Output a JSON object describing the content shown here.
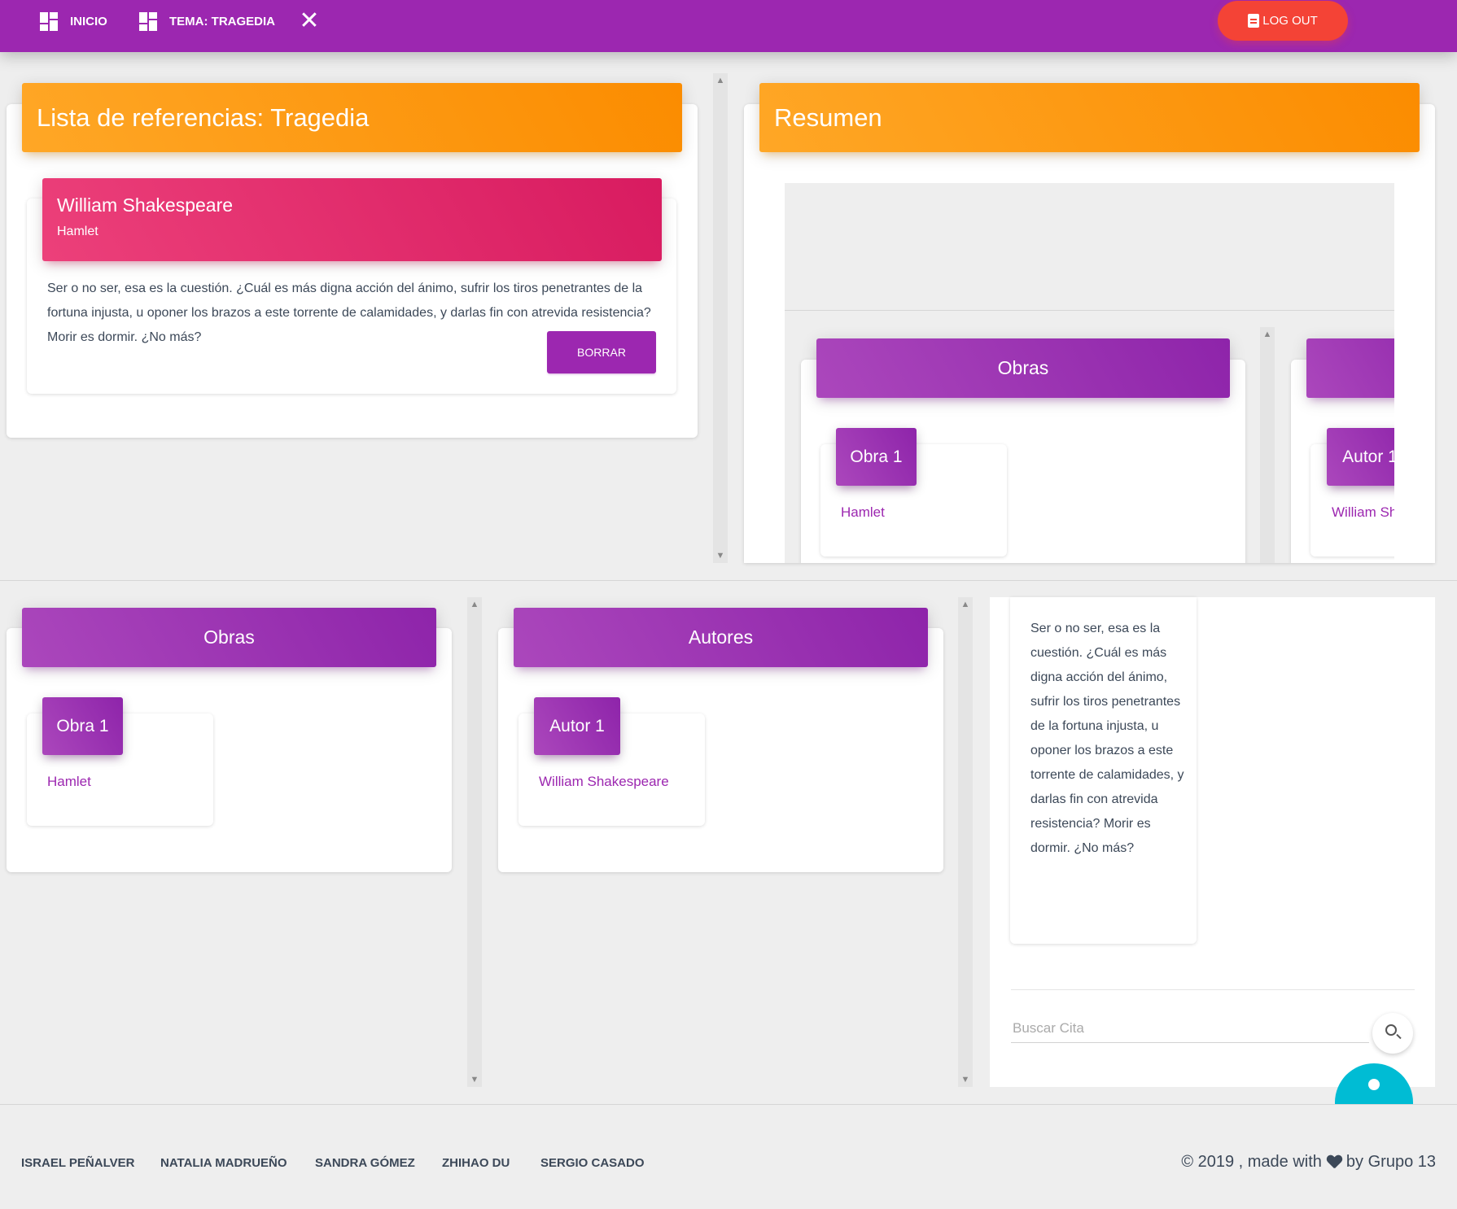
{
  "navbar": {
    "home_label": "INICIO",
    "topic_label": "TEMA: TRAGEDIA",
    "close_glyph": "✕",
    "logout_label": "LOG OUT",
    "color": "#9c27b0"
  },
  "reference_list": {
    "title": "Lista de referencias: Tragedia",
    "reference": {
      "author": "William Shakespeare",
      "work": "Hamlet",
      "quote": "Ser o no ser, esa es la cuestión. ¿Cuál es más digna acción del ánimo, sufrir los tiros penetrantes de la fortuna injusta, u oponer los brazos a este torrente de calamidades, y darlas fin con atrevida resistencia? Morir es dormir. ¿No más?",
      "delete_label": "BORRAR"
    }
  },
  "summary": {
    "title": "Resumen",
    "works_header": "Obras",
    "work_tag": "Obra 1",
    "work_link": "Hamlet",
    "author_tag": "Autor 1",
    "author_link": "William Shakespeare"
  },
  "works_panel": {
    "header": "Obras",
    "tag": "Obra 1",
    "link": "Hamlet"
  },
  "authors_panel": {
    "header": "Autores",
    "tag": "Autor 1",
    "link": "William Shakespeare"
  },
  "quotes_panel": {
    "quote": "Ser o no ser, esa es la cuestión. ¿Cuál es más digna acción del ánimo, sufrir los tiros penetrantes de la fortuna injusta, u oponer los brazos a este torrente de calamidades, y darlas fin con atrevida resistencia? Morir es dormir. ¿No más?",
    "search_placeholder": "Buscar Cita"
  },
  "footer": {
    "links": [
      "ISRAEL PEÑALVER",
      "NATALIA MADRUEÑO",
      "SANDRA GÓMEZ",
      "ZHIHAO DU",
      "SERGIO CASADO"
    ],
    "copyright_prefix": "© 2019 , made with",
    "copyright_suffix": "by Grupo 13"
  },
  "colors": {
    "orange": "#fb8c00",
    "pink": "#d81b60",
    "purple": "#9c27b0",
    "danger": "#f44336",
    "info": "#00bcd4"
  }
}
